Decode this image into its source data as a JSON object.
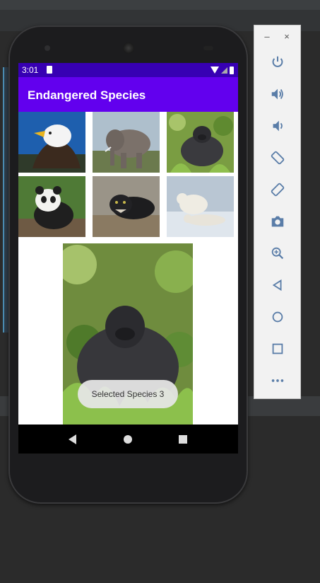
{
  "app": {
    "title": "Endangered Species"
  },
  "status_bar": {
    "time": "3:01"
  },
  "grid": [
    {
      "name": "eagle-thumbnail"
    },
    {
      "name": "elephant-thumbnail"
    },
    {
      "name": "gorilla-thumbnail"
    },
    {
      "name": "panda-thumbnail"
    },
    {
      "name": "panther-thumbnail"
    },
    {
      "name": "polar-bear-thumbnail"
    }
  ],
  "toast": {
    "text": "Selected Species 3"
  },
  "emulator": {
    "tools": [
      "power-icon",
      "volume-up-icon",
      "volume-down-icon",
      "rotate-left-icon",
      "rotate-right-icon",
      "camera-icon",
      "zoom-icon",
      "back-icon",
      "home-icon",
      "overview-icon",
      "more-icon"
    ],
    "window_minimize": "–",
    "window_close": "×"
  },
  "colors": {
    "status_bar": "#3700b3",
    "app_bar": "#6200ee",
    "accent_icon": "#5a7da8"
  }
}
